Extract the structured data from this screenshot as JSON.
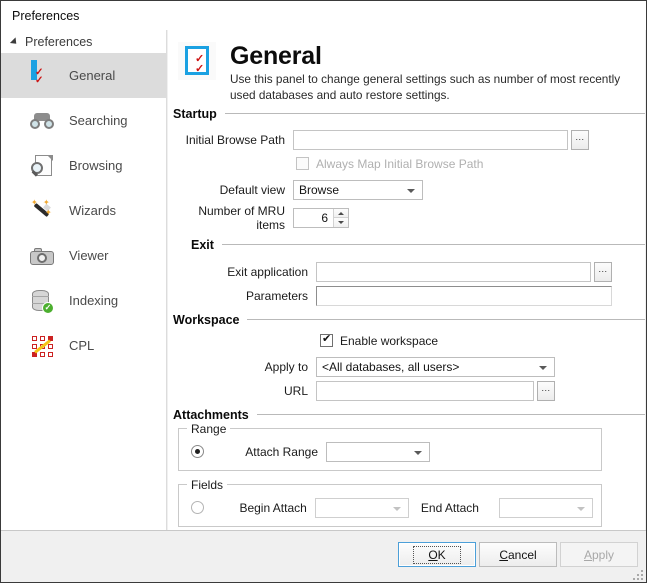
{
  "window": {
    "title": "Preferences"
  },
  "sidebar": {
    "root_label": "Preferences",
    "items": [
      {
        "label": "General",
        "icon": "checklist-icon",
        "selected": true
      },
      {
        "label": "Searching",
        "icon": "binoculars-icon",
        "selected": false
      },
      {
        "label": "Browsing",
        "icon": "page-search-icon",
        "selected": false
      },
      {
        "label": "Wizards",
        "icon": "magic-wand-icon",
        "selected": false
      },
      {
        "label": "Viewer",
        "icon": "camera-icon",
        "selected": false
      },
      {
        "label": "Indexing",
        "icon": "database-check-icon",
        "selected": false
      },
      {
        "label": "CPL",
        "icon": "grid-color-icon",
        "selected": false
      }
    ]
  },
  "panel": {
    "icon": "checklist-icon",
    "title": "General",
    "description": "Use this panel to change general settings such as number of most recently used databases and auto restore settings."
  },
  "startup": {
    "section_label": "Startup",
    "initial_browse_path_label": "Initial Browse Path",
    "initial_browse_path_value": "",
    "browse_button_label": "...",
    "always_map_label": "Always Map Initial Browse Path",
    "always_map_checked": false,
    "always_map_enabled": false,
    "default_view_label": "Default view",
    "default_view_value": "Browse",
    "mru_label": "Number of MRU items",
    "mru_value": "6"
  },
  "exit": {
    "section_label": "Exit",
    "exit_application_label": "Exit application",
    "exit_application_value": "",
    "browse_button_label": "...",
    "parameters_label": "Parameters",
    "parameters_value": ""
  },
  "workspace": {
    "section_label": "Workspace",
    "enable_label": "Enable workspace",
    "enable_checked": true,
    "apply_to_label": "Apply to",
    "apply_to_value": "<All databases, all users>",
    "url_label": "URL",
    "url_value": "",
    "browse_button_label": "..."
  },
  "attachments": {
    "section_label": "Attachments",
    "range_group_label": "Range",
    "range_radio_selected": true,
    "attach_range_label": "Attach Range",
    "attach_range_value": "",
    "fields_group_label": "Fields",
    "fields_radio_selected": false,
    "begin_attach_label": "Begin Attach",
    "begin_attach_value": "",
    "end_attach_label": "End Attach",
    "end_attach_value": ""
  },
  "footer": {
    "ok_label": "OK",
    "ok_accel": "O",
    "cancel_label": "Cancel",
    "cancel_accel": "C",
    "apply_label": "Apply",
    "apply_accel": "A",
    "apply_enabled": false
  }
}
